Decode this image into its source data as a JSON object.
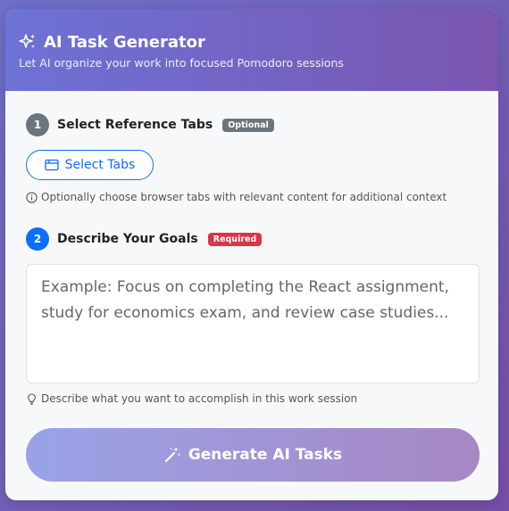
{
  "header": {
    "title": "AI Task Generator",
    "subtitle": "Let AI organize your work into focused Pomodoro sessions",
    "icon": "sparkle-icon"
  },
  "step1": {
    "number": "1",
    "title": "Select Reference Tabs",
    "badge": "Optional",
    "button_label": "Select Tabs",
    "button_icon": "browser-tabs-icon",
    "hint": "Optionally choose browser tabs with relevant content for additional context",
    "hint_icon": "info-icon"
  },
  "step2": {
    "number": "2",
    "title": "Describe Your Goals",
    "badge": "Required",
    "placeholder": "Example: Focus on completing the React assignment, study for economics exam, and review case studies...",
    "value": "",
    "hint": "Describe what you want to accomplish in this work session",
    "hint_icon": "lightbulb-icon"
  },
  "generate": {
    "label": "Generate AI Tasks",
    "icon": "magic-wand-icon"
  },
  "colors": {
    "primary": "#0d6efd",
    "gray_badge": "#6c757d",
    "required_badge": "#dc3545",
    "header_start": "#6d72d6",
    "header_end": "#7a56b0"
  }
}
